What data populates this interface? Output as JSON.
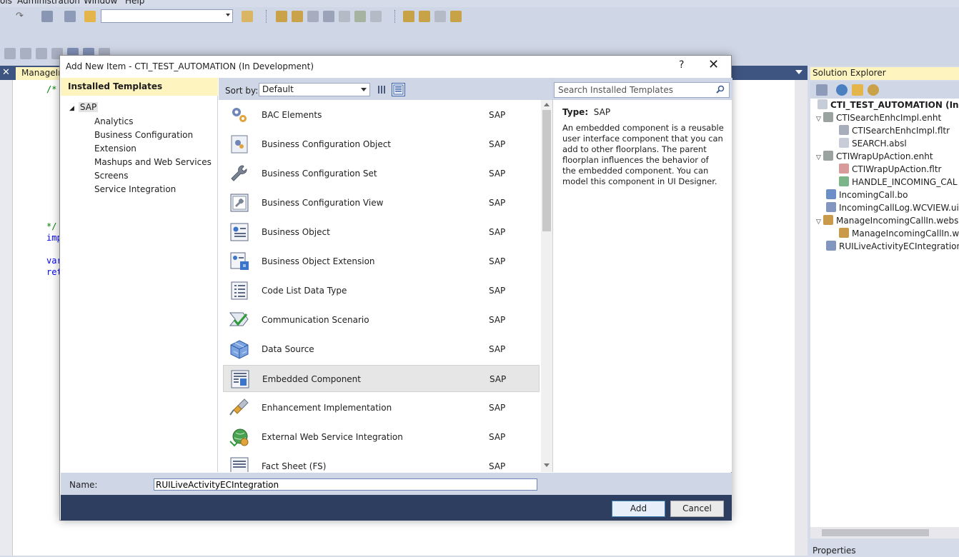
{
  "menubar": {
    "items": [
      "ols",
      "Administration",
      "Window",
      "Help"
    ]
  },
  "editor": {
    "tab_label": "ManageIn",
    "code_lines": [
      "/*",
      "*/",
      "imp",
      "var",
      "ret"
    ]
  },
  "solution_explorer": {
    "title": "Solution Explorer",
    "items": [
      "CTI_TEST_AUTOMATION (In Dev",
      "CTISearchEnhcImpl.enht",
      "CTISearchEnhcImpl.fltr",
      "SEARCH.absl",
      "CTIWrapUpAction.enht",
      "CTIWrapUpAction.fltr",
      "HANDLE_INCOMING_CAL",
      "IncomingCall.bo",
      "IncomingCallLog.WCVIEW.uiv",
      "ManageIncomingCallIn.webse",
      "ManageIncomingCallIn.ws",
      "RUILiveActivityECIntegration.E"
    ],
    "properties_label": "Properties"
  },
  "dialog": {
    "title": "Add New Item - CTI_TEST_AUTOMATION (In Development)",
    "help_label": "?",
    "close_label": "✕",
    "installed_header": "Installed Templates",
    "category_root": "SAP",
    "categories": [
      "Analytics",
      "Business Configuration",
      "Extension",
      "Mashups and Web Services",
      "Screens",
      "Service Integration"
    ],
    "sort_label": "Sort by:",
    "sort_value": "Default",
    "search_placeholder": "Search Installed Templates",
    "templates": [
      {
        "name": "BAC Elements",
        "source": "SAP"
      },
      {
        "name": "Business Configuration Object",
        "source": "SAP"
      },
      {
        "name": "Business Configuration Set",
        "source": "SAP"
      },
      {
        "name": "Business Configuration View",
        "source": "SAP"
      },
      {
        "name": "Business Object",
        "source": "SAP"
      },
      {
        "name": "Business Object Extension",
        "source": "SAP"
      },
      {
        "name": "Code List Data Type",
        "source": "SAP"
      },
      {
        "name": "Communication Scenario",
        "source": "SAP"
      },
      {
        "name": "Data Source",
        "source": "SAP"
      },
      {
        "name": "Embedded Component",
        "source": "SAP"
      },
      {
        "name": "Enhancement Implementation",
        "source": "SAP"
      },
      {
        "name": "External Web Service Integration",
        "source": "SAP"
      },
      {
        "name": "Fact Sheet (FS)",
        "source": "SAP"
      }
    ],
    "type_label": "Type:",
    "type_value": "SAP",
    "description": "An embedded component is a reusable user interface component that you can add to other floorplans. The parent floorplan influences the behavior of the embedded component. You can model this component in UI Designer.",
    "name_label": "Name:",
    "name_value": "RUILiveActivityECIntegration",
    "add_label": "Add",
    "cancel_label": "Cancel"
  }
}
